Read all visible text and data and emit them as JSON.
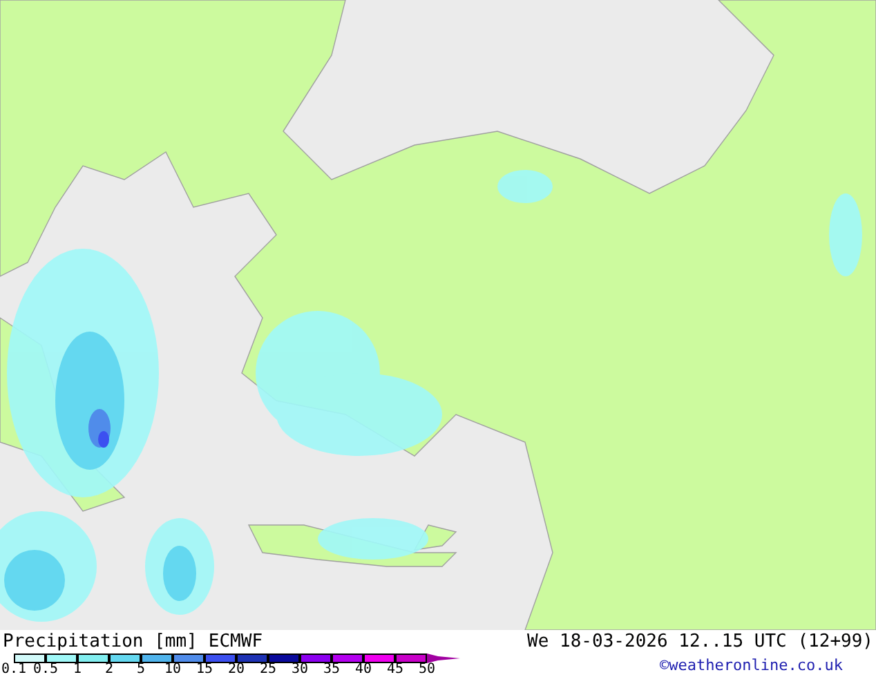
{
  "map": {
    "footer": {
      "title": "Precipitation [mm]",
      "model": "ECMWF",
      "valid_time": "We 18-03-2026 12..15 UTC (12+99)",
      "credit": "©weatheronline.co.uk"
    }
  },
  "legend": {
    "bins": [
      {
        "kind": "swatch",
        "color": "#d2fafa"
      },
      {
        "kind": "swatch",
        "color": "#a0f8f8"
      },
      {
        "kind": "swatch",
        "color": "#82eef0"
      },
      {
        "kind": "swatch",
        "color": "#64d8f0"
      },
      {
        "kind": "swatch",
        "color": "#50b4ec"
      },
      {
        "kind": "swatch",
        "color": "#508cea"
      },
      {
        "kind": "swatch",
        "color": "#3c50f0"
      },
      {
        "kind": "swatch",
        "color": "#1e32b4"
      },
      {
        "kind": "swatch",
        "color": "#0a0a9c"
      },
      {
        "kind": "swatch",
        "color": "#8c00f0"
      },
      {
        "kind": "swatch",
        "color": "#b400f0"
      },
      {
        "kind": "swatch",
        "color": "#f000f0"
      },
      {
        "kind": "swatch",
        "color": "#c800c8"
      },
      {
        "kind": "arrow",
        "color": "#a000a0"
      }
    ],
    "ticks": [
      "0.1",
      "0.5",
      "1",
      "2",
      "5",
      "10",
      "15",
      "20",
      "25",
      "30",
      "35",
      "40",
      "45",
      "50"
    ]
  }
}
